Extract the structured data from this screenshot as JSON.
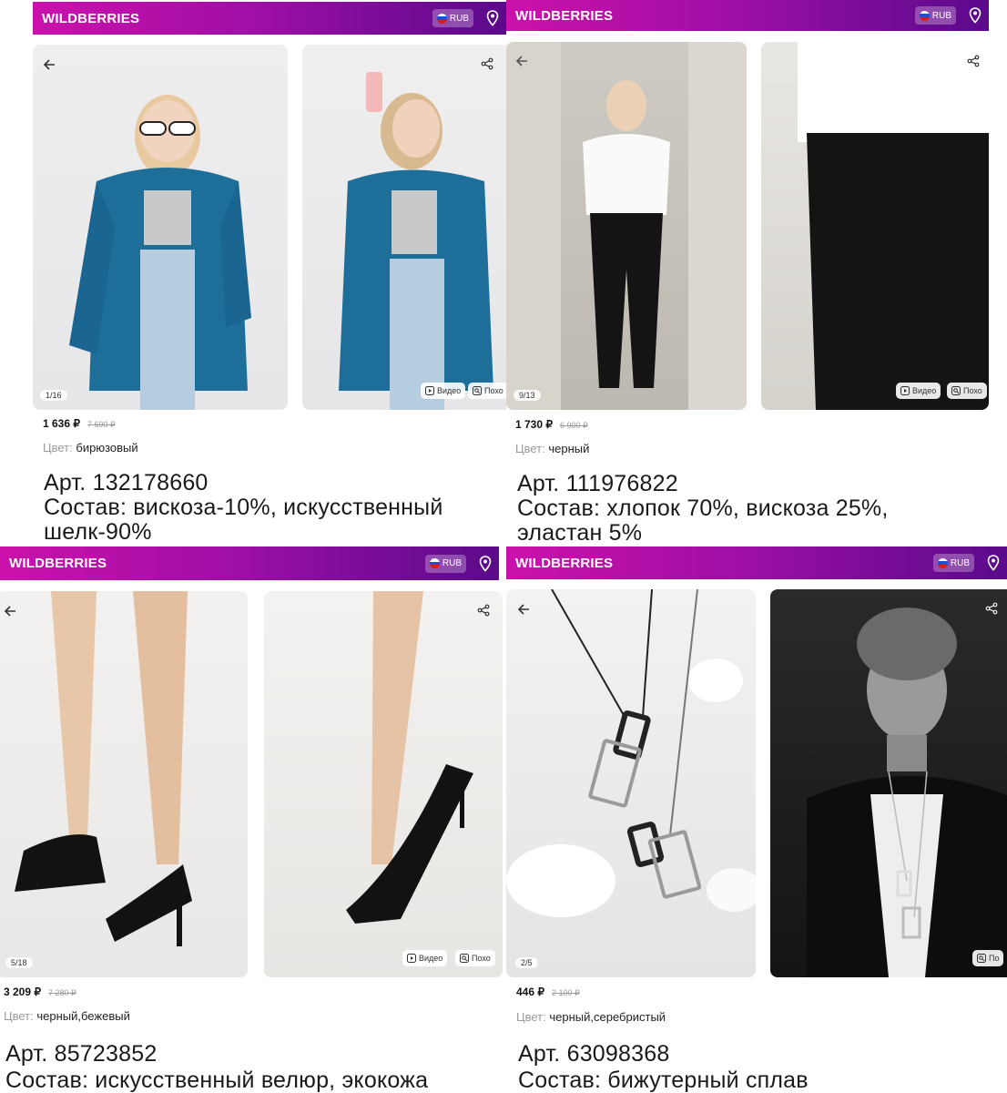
{
  "header": {
    "logo": "WILDBERRIES",
    "currency": "RUB",
    "accent_colors": [
      "#cb11ab",
      "#a00fa6",
      "#5a0a8a"
    ]
  },
  "icons": {
    "back": "back-arrow-icon",
    "share": "share-icon",
    "location": "location-pin-icon",
    "video": "play-icon",
    "similar": "similar-search-icon",
    "flag": "russia-flag-icon"
  },
  "products": [
    {
      "counter": "1/16",
      "video_label": "Видео",
      "similar_label": "Похо",
      "price": "1 636 ₽",
      "old_price": "7 690 ₽",
      "color_label": "Цвет:",
      "color_value": "бирюзовый",
      "article": "Арт. 132178660",
      "composition_line1": "Состав: вискоза-10%, искусственный",
      "composition_line2": "шелк-90%"
    },
    {
      "counter": "9/13",
      "video_label": "Видео",
      "similar_label": "Похо",
      "price": "1 730 ₽",
      "old_price": "6 900 ₽",
      "color_label": "Цвет:",
      "color_value": "черный",
      "article": "Арт. 111976822",
      "composition_line1": "Состав: хлопок 70%, вискоза 25%,",
      "composition_line2": "эластан 5%"
    },
    {
      "counter": "5/18",
      "video_label": "Видео",
      "similar_label": "Похо",
      "price": "3 209 ₽",
      "old_price": "7 280 ₽",
      "color_label": "Цвет:",
      "color_value": "черный,бежевый",
      "article": "Арт. 85723852",
      "composition_line1": "Состав: искусственный велюр, экокожа",
      "composition_line2": ""
    },
    {
      "counter": "2/5",
      "video_label": "",
      "similar_label": "По",
      "price": "446 ₽",
      "old_price": "2 100 ₽",
      "color_label": "Цвет:",
      "color_value": "черный,серебристый",
      "article": "Арт. 63098368",
      "composition_line1": "Состав: бижутерный сплав",
      "composition_line2": ""
    }
  ]
}
